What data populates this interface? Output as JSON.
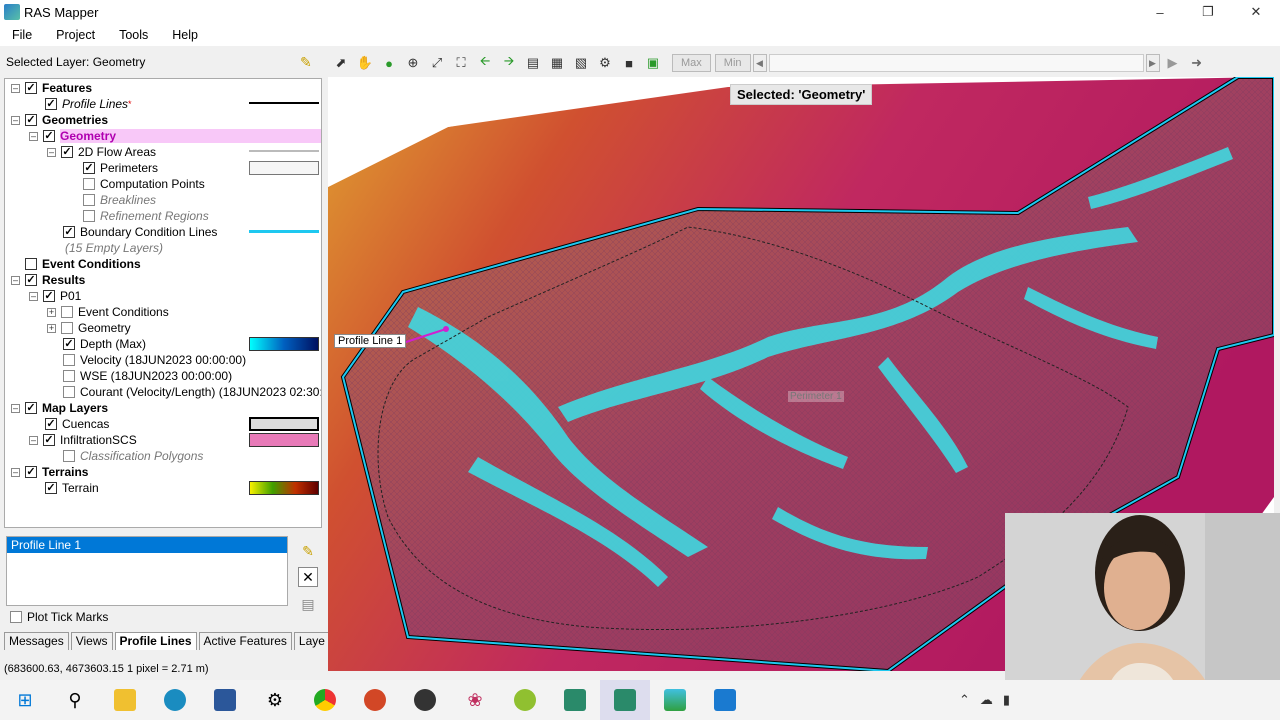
{
  "window": {
    "title": "RAS Mapper",
    "min_icon": "minimize-icon",
    "max_icon": "restore-icon",
    "close_icon": "close-icon"
  },
  "menu": [
    "File",
    "Project",
    "Tools",
    "Help"
  ],
  "selected_layer": "Selected Layer: Geometry",
  "toolbar": {
    "max": "Max",
    "min": "Min"
  },
  "tree": {
    "features": "Features",
    "profile_lines": "Profile Lines",
    "profile_lines_flag": "*",
    "geometries": "Geometries",
    "geometry": "Geometry",
    "flow_areas": "2D Flow Areas",
    "perimeters": "Perimeters",
    "computation_points": "Computation Points",
    "breaklines": "Breaklines",
    "refinement_regions": "Refinement Regions",
    "bc_lines": "Boundary Condition Lines",
    "empty_layers": "(15 Empty Layers)",
    "event_conditions": "Event Conditions",
    "results": "Results",
    "p01": "P01",
    "p01_event_conditions": "Event Conditions",
    "p01_geometry": "Geometry",
    "depth": "Depth (Max)",
    "velocity": "Velocity (18JUN2023 00:00:00)",
    "wse": "WSE (18JUN2023 00:00:00)",
    "courant": "Courant (Velocity/Length) (18JUN2023 02:30:00)",
    "map_layers": "Map Layers",
    "cuencas": "Cuencas",
    "infiltration": "InfiltrationSCS",
    "classification": "Classification Polygons",
    "terrains": "Terrains",
    "terrain": "Terrain"
  },
  "profile_list": [
    "Profile Line 1"
  ],
  "plot_tick_marks": "Plot Tick Marks",
  "tabs": [
    "Messages",
    "Views",
    "Profile Lines",
    "Active Features",
    "Laye"
  ],
  "active_tab": "Profile Lines",
  "status": "(683600.63, 4673603.15  1 pixel = 2.71 m)",
  "map": {
    "selected_label": "Selected: 'Geometry'",
    "profile_label": "Profile Line 1",
    "perimeter_label": "Perimeter 1"
  },
  "colors": {
    "accent": "#0078d7",
    "bc_line": "#1ec8f0",
    "selection": "#f8c8f8"
  },
  "taskbar": [
    "windows-start-icon",
    "search-icon",
    "file-explorer-icon",
    "app-icon",
    "word-icon",
    "settings-icon",
    "chrome-icon",
    "powerpoint-icon",
    "app-icon",
    "app-icon",
    "qgis-icon",
    "ras-icon",
    "ras-icon",
    "app-icon",
    "photos-icon"
  ]
}
